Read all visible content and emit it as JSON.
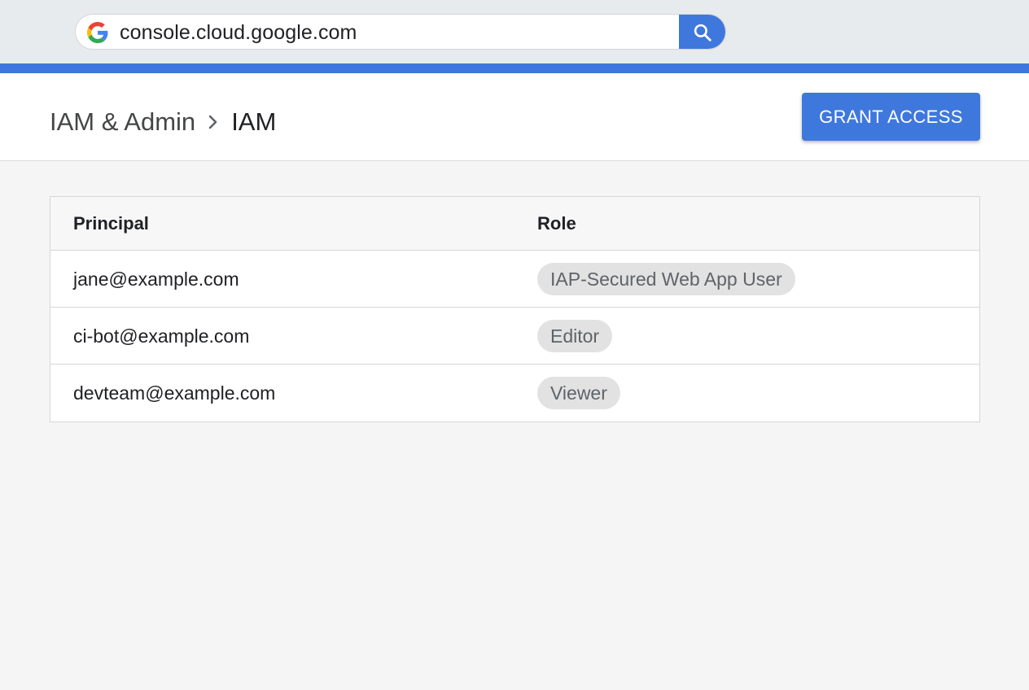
{
  "browser": {
    "url": "console.cloud.google.com"
  },
  "header": {
    "breadcrumb_parent": "IAM & Admin",
    "breadcrumb_current": "IAM",
    "grant_access_label": "GRANT ACCESS"
  },
  "table": {
    "columns": [
      "Principal",
      "Role"
    ],
    "rows": [
      {
        "principal": "jane@example.com",
        "role": "IAP-Secured Web App User"
      },
      {
        "principal": "ci-bot@example.com",
        "role": "Editor"
      },
      {
        "principal": "devteam@example.com",
        "role": "Viewer"
      }
    ]
  },
  "icons": {
    "address_bar": "google-g-icon",
    "search": "search-icon",
    "breadcrumb_separator": "chevron-right-icon"
  },
  "colors": {
    "accent": "#3f78dd",
    "chip_bg": "#e2e2e2",
    "chrome_bg": "#e8ebee"
  }
}
